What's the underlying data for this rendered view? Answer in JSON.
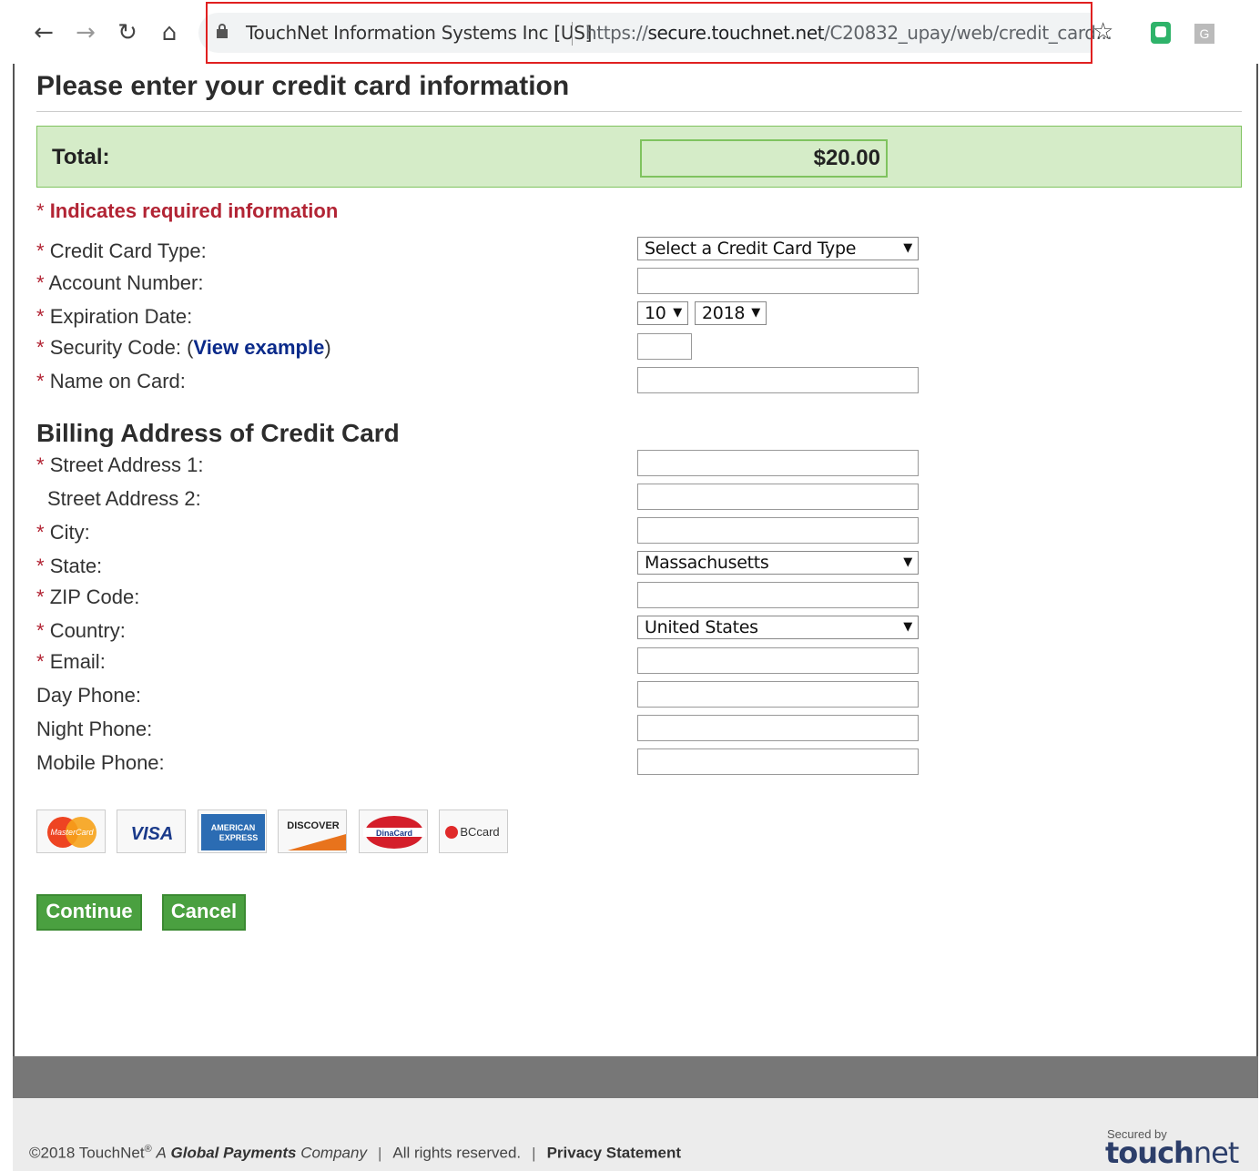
{
  "browser": {
    "org": "TouchNet Information Systems Inc [US]",
    "url_prefix": "https://",
    "url_host": "secure.touchnet.net",
    "url_path": "/C20832_upay/web/credit_card...",
    "ext2_letter": "G"
  },
  "page": {
    "title": "Please enter your credit card information",
    "total_label": "Total:",
    "total_amount": "$20.00",
    "required_ast": "*",
    "required_note": "Indicates required information"
  },
  "fields": {
    "card_type": "Credit Card Type:",
    "account_number": "Account Number:",
    "expiration": "Expiration Date:",
    "security_code": "Security Code: (",
    "view_example": "View example",
    "security_close": ")",
    "name_on_card": "Name on Card:",
    "billing_title": "Billing Address of Credit Card",
    "street1": "Street Address 1:",
    "street2": "Street Address 2:",
    "city": "City:",
    "state": "State:",
    "zip": "ZIP Code:",
    "country": "Country:",
    "email": "Email:",
    "day_phone": "Day Phone:",
    "night_phone": "Night Phone:",
    "mobile_phone": "Mobile Phone:"
  },
  "selects": {
    "card_type": "Select a Credit Card Type",
    "exp_month": "10",
    "exp_year": "2018",
    "state": "Massachusetts",
    "country": "United States",
    "arrow": "▼"
  },
  "cards": {
    "mastercard": "MasterCard",
    "visa": "VISA",
    "amex_1": "AMERICAN",
    "amex_2": "EXPRESS",
    "discover": "DISCOVER",
    "dinacard": "DinaCard",
    "bccard": "BCcard"
  },
  "buttons": {
    "continue": "Continue",
    "cancel": "Cancel"
  },
  "footer": {
    "copyright": "©2018 TouchNet",
    "reg": "®",
    "global_a": "A",
    "global_b": "Global Payments",
    "global_c": "Company",
    "rights": "All rights reserved.",
    "privacy": "Privacy Statement",
    "secured_by": "Secured by",
    "logo_touch": "touch",
    "logo_net": "net"
  },
  "colors": {
    "total_bg": "#d5ecc8",
    "required_red": "#b22434",
    "link_blue": "#0a2a8a",
    "button_green": "#4aa040"
  }
}
